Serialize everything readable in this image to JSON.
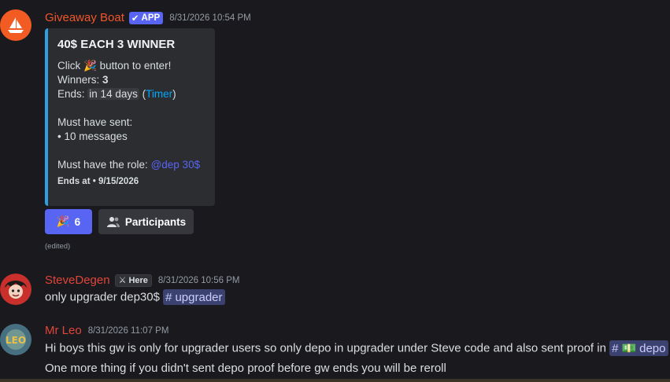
{
  "messages": {
    "giveaway": {
      "username": "Giveaway Boat",
      "username_color": "#f0562a",
      "badge": "APP",
      "timestamp": "8/31/2026 10:54 PM",
      "embed": {
        "title": "40$ EACH 3 WINNER",
        "click_prefix": "Click",
        "click_suffix": "button to enter!",
        "winners_label": "Winners:",
        "winners_value": "3",
        "ends_label": "Ends:",
        "ends_value": "in 14 days",
        "open_paren": "(",
        "timer_link": "Timer",
        "close_paren": ")",
        "must_sent_label": "Must have sent:",
        "must_sent_item": "• 10 messages",
        "role_label": "Must have the role:",
        "role_value": "@dep 30$",
        "footer": "Ends at • 9/15/2026",
        "accent_color": "#2e9fe0"
      },
      "buttons": {
        "enter_count": "6",
        "participants_label": "Participants"
      },
      "edited": "(edited)"
    },
    "steve": {
      "username": "SteveDegen",
      "username_color": "#e0453a",
      "tag": "Here",
      "timestamp": "8/31/2026 10:56 PM",
      "content_text": "only upgrader dep30$",
      "channel_name": "upgrader"
    },
    "leo": {
      "username": "Mr Leo",
      "username_color": "#e0453a",
      "timestamp": "8/31/2026 11:07 PM",
      "line1": "Hi boys this gw is only for upgrader users so only depo in upgrader under Steve code and also sent proof in",
      "channel_name": "depo",
      "line2": "One more thing if you didn't sent depo proof before gw ends you will be reroll"
    }
  },
  "colors": {
    "background": "#1a1a1e",
    "blurple": "#5865f2",
    "link": "#00a8fc"
  }
}
